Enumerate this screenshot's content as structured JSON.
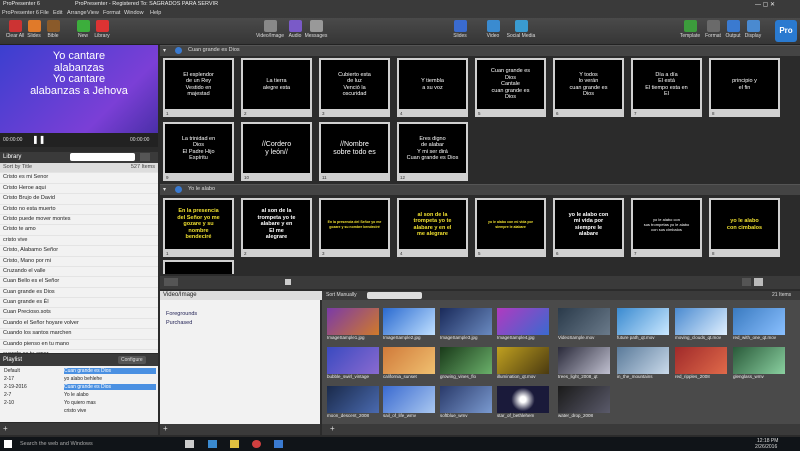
{
  "title_bar": {
    "app": "ProPresenter 6",
    "title": "ProPresenter - Registered To: SAGRADOS PARA SERVIR"
  },
  "menu": [
    "ProPresenter 6",
    "File",
    "Edit",
    "Arrange",
    "View",
    "Format",
    "Window",
    "Help"
  ],
  "toolbar": {
    "left": [
      "Clear All",
      "Slides",
      "Bible",
      "New",
      "Library"
    ],
    "center": [
      "Video/Image",
      "Audio",
      "Messages"
    ],
    "right": [
      "Slides",
      "Video",
      "Social Media"
    ],
    "far_right": [
      "Template",
      "Format",
      "Output",
      "Display"
    ]
  },
  "preview_text": "Yo cantare\nalabanzas\nYo cantare\nalabanzas a Jehova",
  "transport": {
    "time_left": "00:00:00",
    "time_right": "00:00:00"
  },
  "library": {
    "header": "Library",
    "sort_label": "Sort by Title",
    "count": "527 Items",
    "items": [
      "Cristo es mi Senor",
      "Cristo Heroe aqui",
      "Cristo Brujo de David",
      "Cristo no esta muerto",
      "Cristo puede mover montes",
      "Cristo te amo",
      "cristo vive",
      "Cristo, Alabamo Señor",
      "Cristo, Mano por mi",
      "Cruzando el valle",
      "Cuan Bello es el Señor",
      "Cuan grande es Dios",
      "Cuan grande es Él",
      "Cuan Precioso.sots",
      "Cuando el Señor hoyare volver",
      "Cuando los santos marchen",
      "Cuando pienso en tu mano",
      "cuando se tu amor"
    ]
  },
  "playlist": {
    "header": "Playlist",
    "configure": "Configure",
    "dates": [
      "Default",
      "2-17",
      "2-19-2016",
      "2-7",
      "2-10"
    ],
    "songs": [
      "Cuan grande es Dios",
      "yo alabo behlehe",
      "Cuan grande es Dios",
      "Yo le alabo",
      "Yo quiero mas",
      "cristo vive"
    ]
  },
  "groups": [
    {
      "title": "Cuan grande es Dios",
      "slides": [
        {
          "n": "1",
          "text": "El esplendor\nde un Rey\nVestido en\nmajestad"
        },
        {
          "n": "2",
          "text": "La tierra\nalegre esta"
        },
        {
          "n": "3",
          "text": "Cubierto esta\nde luz\nVenció la\noscuridad"
        },
        {
          "n": "4",
          "text": "Y tiembla\na su voz"
        },
        {
          "n": "5",
          "text": "Cuan grande es\nDios\nCantale\ncuan grande es\nDios"
        },
        {
          "n": "6",
          "text": "Y todos\nlo verán\ncuan grande es\nDios"
        },
        {
          "n": "7",
          "text": "Día a día\nEl está\nEl tiempo esta en\nEl"
        },
        {
          "n": "8",
          "text": "principio y\nel fin"
        },
        {
          "n": "9",
          "text": "La trinidad en\nDios\nEl Padre Hijo\nEspíritu"
        },
        {
          "n": "10",
          "text": "//Cordero\ny león//"
        },
        {
          "n": "11",
          "text": "//Nombre\nsobre todo es"
        },
        {
          "n": "12",
          "text": "Eres digno\nde alabar\nY mi ser dirá\nCuan grande es Dios"
        }
      ]
    },
    {
      "title": "Yo le alabo",
      "slides": [
        {
          "n": "1",
          "text": "En la presencia\ndel Señor yo me\ngozare y su\nnombre\nbendeciré"
        },
        {
          "n": "2",
          "text": "al son de la\ntrompeta yo te\nalabare y en\nEl me\nalegrare"
        },
        {
          "n": "3",
          "text": "En la presencia del Señor yo me\ngozare y su nombre bendeciré"
        },
        {
          "n": "4",
          "text": "al son de la\ntrompeta yo te\nalabare y en el\nme alegrare"
        },
        {
          "n": "5",
          "text": "yo le alabo con mi vida por\nsiempre le alabare"
        },
        {
          "n": "6",
          "text": "yo le alabo con\nmi vida por\nsiempre le\nalabare"
        },
        {
          "n": "7",
          "text": "yo le alabo con\nsus trompetas yo le alabo\ncon sus cimbalos"
        },
        {
          "n": "8",
          "text": "yo le alabo\ncon cimbalos"
        }
      ]
    }
  ],
  "media": {
    "header": "Video/Image",
    "tree": [
      "Foregrounds",
      "Purchased"
    ],
    "sort_label": "Sort Manually",
    "count": "21 Items",
    "thumbs": [
      "ImageSample1.jpg",
      "ImageSample2.jpg",
      "ImageSample3.jpg",
      "ImageSample4.jpg",
      "VideoSample.mov",
      "future path_qt.mov",
      "moving_clouds_qt.mov",
      "red_with_one_qt.mov",
      "bubble_swirl_vintage",
      "california_sunset",
      "growing_vines_flo",
      "illumination_qt.mov",
      "trees_light_2008_qt",
      "in_the_mountains",
      "red_ripples_2008",
      "glenglass_wmv",
      "moon_descent_2008",
      "sail_of_life_wmv",
      "softblue_wmv",
      "star_of_bethlehem",
      "water_drop_2008"
    ]
  },
  "taskbar": {
    "search": "Search the web and Windows",
    "time": "12:18 PM",
    "date": "2/26/2016"
  }
}
